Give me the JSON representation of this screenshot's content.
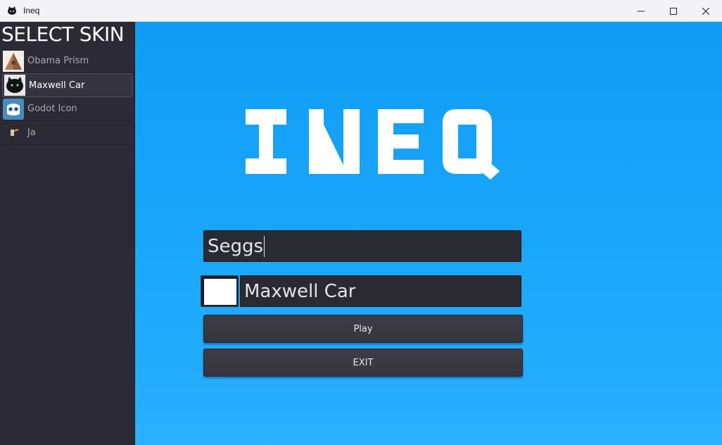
{
  "window": {
    "title": "Ineq",
    "controls": {
      "minimize": "—",
      "maximize": "☐",
      "close": "✕"
    }
  },
  "sidebar": {
    "title": "SELECT SKIN",
    "items": [
      {
        "label": "Obama Prism",
        "icon": "obama-prism-thumbnail",
        "selected": false
      },
      {
        "label": "Maxwell Car",
        "icon": "maxwell-car-thumbnail",
        "selected": true
      },
      {
        "label": "Godot Icon",
        "icon": "godot-icon-thumbnail",
        "selected": false
      },
      {
        "label": "Ja",
        "icon": "ja-thumbnail",
        "selected": false
      }
    ]
  },
  "main": {
    "logo_text": "INEQ",
    "name_input": {
      "value": "Seggs"
    },
    "skin_preview_color": "#ffffff",
    "selected_skin_label": "Maxwell Car",
    "play_label": "Play",
    "exit_label": "EXIT"
  },
  "colors": {
    "background_top": "#0f9cf5",
    "background_bottom": "#29b0fe",
    "panel": "#2b2a35",
    "button": "#3b3a45"
  }
}
